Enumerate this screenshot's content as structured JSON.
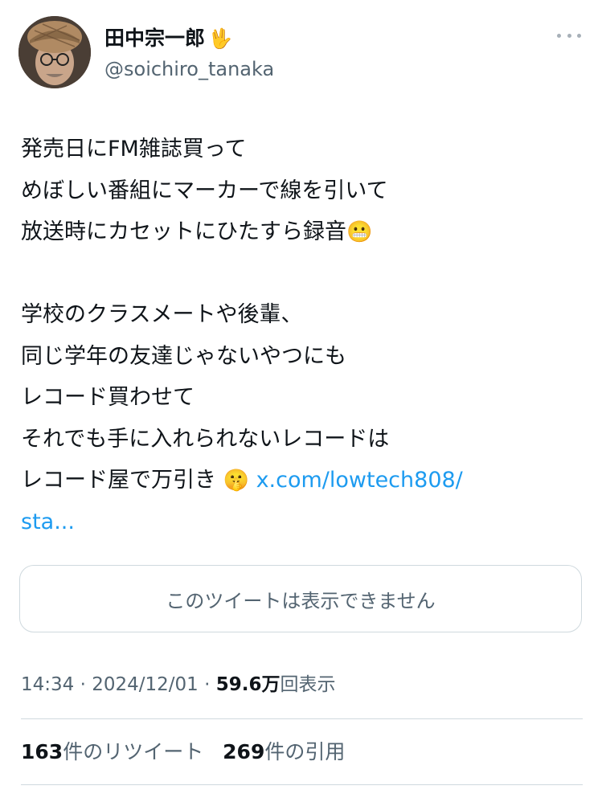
{
  "author": {
    "display_name": "田中宗一郎",
    "name_emoji": "🖖",
    "handle": "@soichiro_tanaka",
    "more_icon": "more-dots-icon"
  },
  "tweet": {
    "paragraph1": [
      "発売日にFM雑誌買って",
      "めぼしい番組にマーカーで線を引いて",
      "放送時にカセットにひたすら録音"
    ],
    "paragraph1_emoji": "😬",
    "paragraph2": [
      "学校のクラスメートや後輩、",
      "同じ学年の友達じゃないやつにも",
      "レコード買わせて",
      "それでも手に入れられないレコードは",
      "レコード屋で万引き"
    ],
    "paragraph2_emoji": "🤫",
    "link_text_1": "x.com/lowtech808/",
    "link_text_2": "sta..."
  },
  "quoted_unavailable": "このツイートは表示できません",
  "meta": {
    "time": "14:34",
    "date": "2024/12/01",
    "views_count": "59.6万",
    "views_label": "回表示"
  },
  "stats": {
    "retweets_count": "163",
    "retweets_label": "件のリツイート",
    "quotes_count": "269",
    "quotes_label": "件の引用"
  }
}
